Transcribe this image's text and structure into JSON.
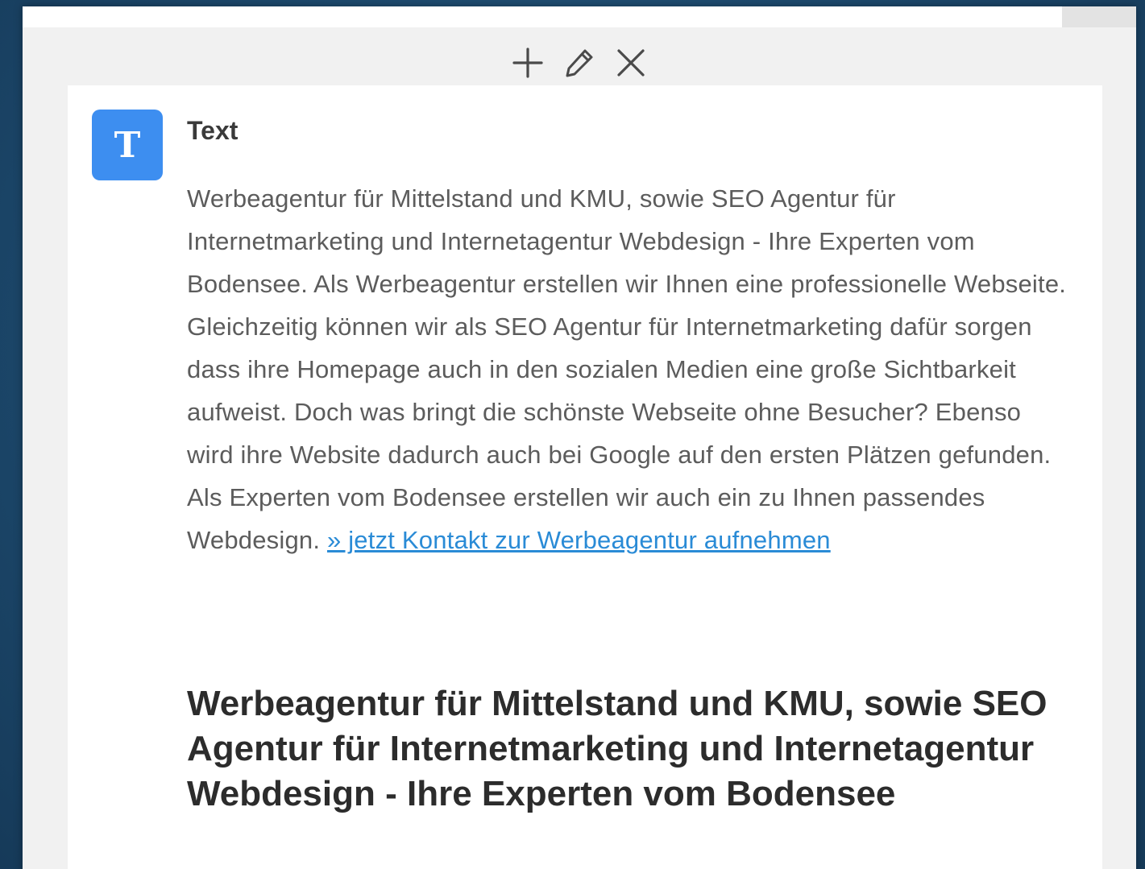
{
  "toolbar": {
    "add_icon": "plus-icon",
    "edit_icon": "pencil-icon",
    "close_icon": "close-icon"
  },
  "module": {
    "icon_letter": "T",
    "icon_color": "#3d8ef0",
    "title": "Text",
    "paragraph": "Werbeagentur für Mittelstand und KMU, sowie SEO Agentur für Internetmarketing und Internetagentur Webdesign - Ihre Experten vom Bodensee. Als Werbeagentur erstellen wir Ihnen eine professionelle Webseite. Gleichzeitig können wir als SEO Agentur für Internetmarketing dafür sorgen dass ihre Homepage auch in den sozialen Medien eine große Sichtbarkeit aufweist. Doch was bringt die schönste Webseite ohne Besucher? Ebenso wird ihre Website dadurch auch bei Google auf den ersten Plätzen gefunden.  Als Experten vom Bodensee erstellen wir auch ein zu Ihnen passendes Webdesign. ",
    "link_text": "» jetzt Kontakt zur Werbeagentur aufnehmen",
    "link_color": "#2a8bd6",
    "heading": "Werbeagentur für Mittelstand und KMU, sowie SEO Agentur für Internetmarketing und Internetagentur Webdesign - Ihre Experten vom Bodensee"
  }
}
